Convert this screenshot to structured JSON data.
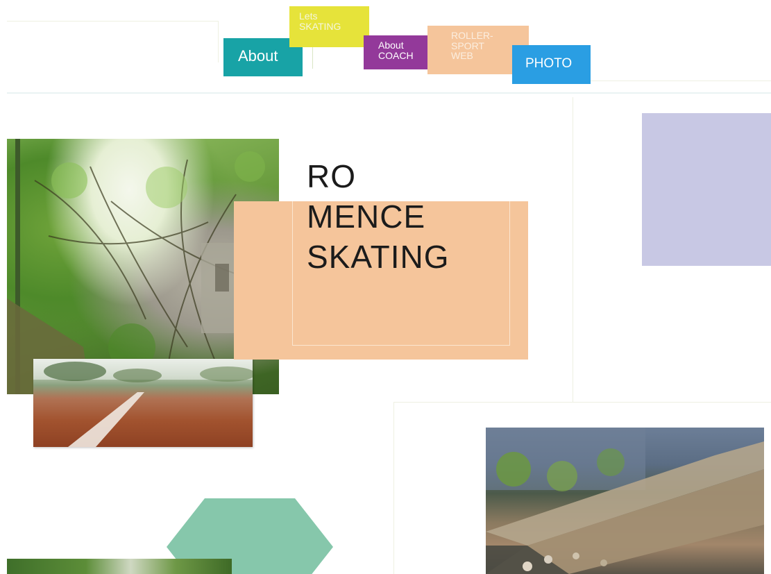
{
  "nav": {
    "about": "About",
    "lets_skating_line1": "Lets",
    "lets_skating_line2": "SKATING",
    "about_coach_line1": "About",
    "about_coach_line2": "COACH",
    "roller_line1": "ROLLER-",
    "roller_line2": "SPORT",
    "roller_line3": "WEB",
    "photo": "PHOTO"
  },
  "hero": {
    "title_line1": "RO",
    "title_line2": "MENCE",
    "title_line3": "SKATING"
  },
  "colors": {
    "teal": "#18a3a6",
    "yellow": "#e6e33a",
    "purple": "#93399a",
    "peach": "#f5c59b",
    "blue": "#2a9ee3",
    "lavender": "#c8c8e4",
    "mint": "#86c7ab"
  }
}
